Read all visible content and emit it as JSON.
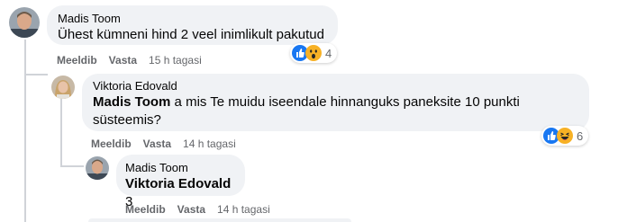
{
  "comments": [
    {
      "author": "Madis Toom",
      "text": "Ühest kümneni hind 2 veel inimlikult pakutud",
      "actions": {
        "like": "Meeldib",
        "reply": "Vasta",
        "time": "15 h tagasi"
      },
      "reactions": {
        "icons": [
          "like-icon",
          "wow-icon"
        ],
        "count": "4"
      }
    },
    {
      "author": "Viktoria Edovald",
      "mention": "Madis Toom",
      "text": " a mis Te muidu iseendale hinnanguks paneksite 10 punkti süsteemis?",
      "actions": {
        "like": "Meeldib",
        "reply": "Vasta",
        "time": "14 h tagasi"
      },
      "reactions": {
        "icons": [
          "like-icon",
          "haha-icon"
        ],
        "count": "6"
      }
    },
    {
      "author": "Madis Toom",
      "mention": "Viktoria Edovald",
      "text": " 3",
      "actions": {
        "like": "Meeldib",
        "reply": "Vasta",
        "time": "14 h tagasi"
      }
    }
  ],
  "colors": {
    "bubble": "#f0f2f5",
    "meta": "#65676b",
    "like_blue": "#1877f2",
    "reaction_yellow": "#f7b125"
  }
}
